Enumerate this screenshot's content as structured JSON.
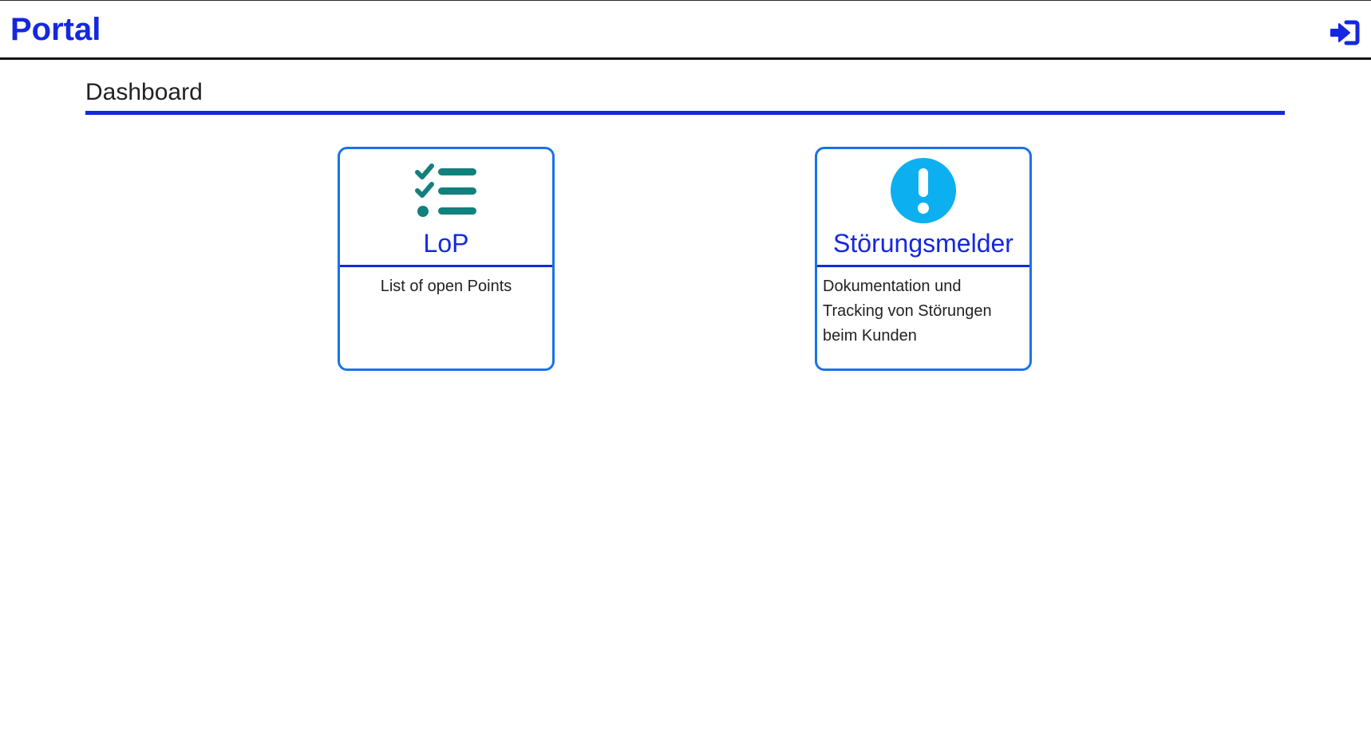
{
  "app": {
    "title": "Portal"
  },
  "header": {
    "login_icon": "sign-in-icon"
  },
  "page": {
    "title": "Dashboard"
  },
  "cards": [
    {
      "title": "LoP",
      "description": "List of open Points",
      "icon": "checklist-icon"
    },
    {
      "title": "Störungsmelder",
      "description": "Dokumentation und Tracking von Störungen beim Kunden",
      "icon": "exclamation-circle-icon"
    }
  ],
  "colors": {
    "brand": "#1428e0",
    "card_border": "#1a73e8",
    "checklist_icon": "#12807c",
    "alert_icon": "#0cb0f0"
  }
}
